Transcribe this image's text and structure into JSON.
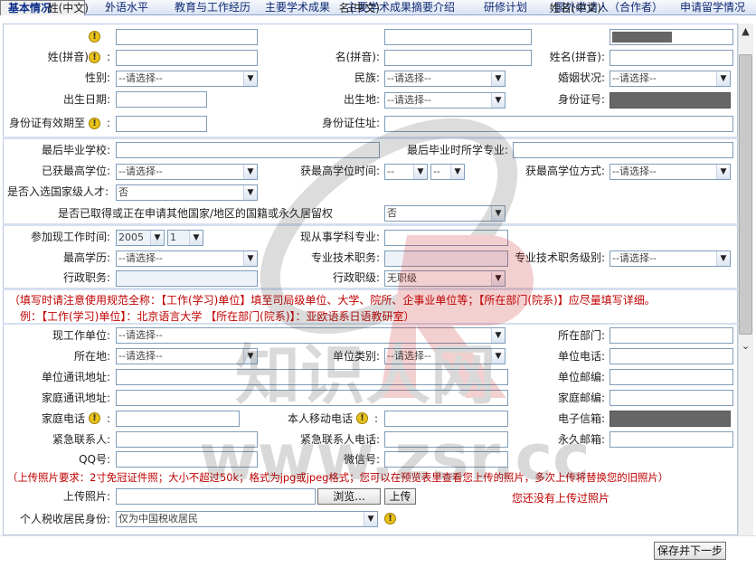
{
  "tabs": [
    "基本情况",
    "外语水平",
    "教育与工作经历",
    "主要学术成果",
    "主要学术成果摘要介绍",
    "研修计划",
    "国外邀请人（合作者）",
    "申请留学情况"
  ],
  "placeholder_select": "--请选择--",
  "watermark": {
    "line1": "知识人网",
    "line2": "www.zsr.cc"
  },
  "labels": {
    "surname_cn": "姓(中文)",
    "name_cn": "名(中文)",
    "fullname_cn": "姓名(中文):",
    "surname_py": "姓(拼音)",
    "name_py": "名(拼音):",
    "fullname_py": "姓名(拼音):",
    "gender": "性别:",
    "ethnicity": "民族:",
    "marital": "婚姻状况:",
    "birth_date": "出生日期:",
    "birth_place": "出生地:",
    "id_number": "身份证号:",
    "id_valid": "身份证有效期至",
    "id_address": "身份证住址:",
    "last_school": "最后毕业学校:",
    "last_major": "最后毕业时所学专业:",
    "highest_degree": "已获最高学位:",
    "degree_time": "获最高学位时间:",
    "degree_method": "获最高学位方式:",
    "national_talent": "是否入选国家级人才:",
    "foreign_residency": "是否已取得或正在申请其他国家/地区的国籍或永久居留权",
    "work_start": "参加现工作时间:",
    "current_field": "现从事学科专业:",
    "education": "最高学历:",
    "tech_title": "专业技术职务:",
    "tech_level": "专业技术职务级别:",
    "admin_title": "行政职务:",
    "admin_level": "行政职级:",
    "work_unit": "现工作单位:",
    "department": "所在部门:",
    "location": "所在地:",
    "unit_type": "单位类别:",
    "unit_phone": "单位电话:",
    "unit_address": "单位通讯地址:",
    "unit_zip": "单位邮编:",
    "home_address": "家庭通讯地址:",
    "home_zip": "家庭邮编:",
    "home_phone": "家庭电话",
    "mobile": "本人移动电话",
    "email": "电子信箱:",
    "emergency_contact": "紧急联系人:",
    "emergency_phone": "紧急联系人电话:",
    "perm_zip": "永久邮箱:",
    "qq": "QQ号:",
    "wechat": "微信号:",
    "photo": "上传照片:",
    "tax_status": "个人税收居民身份:"
  },
  "values": {
    "national_talent": "否",
    "foreign_residency": "否",
    "admin_level": "无职级",
    "work_year": "2005",
    "work_month": "1",
    "degree_year": "--",
    "degree_month": "--",
    "tax_status": "仅为中国税收居民"
  },
  "notice1": "（填写时请注意使用规范全称：【工作(学习)单位】填至司局级单位、大学、院所、企事业单位等；【所在部门(院系)】应尽量填写详细。",
  "notice2": "例：【工作(学习)单位】：北京语言大学    【所在部门(院系)】：亚欧语系日语教研室）",
  "photo_notice": "（上传照片要求：2寸免冠证件照；大小不超过50k；格式为jpg或jpeg格式；您可以在预览表里查看您上传的照片，多次上传将替换您的旧照片）",
  "buttons": {
    "browse": "浏览...",
    "upload": "上传",
    "save_next": "保存并下一步"
  },
  "photo_status": "您还没有上传过照片"
}
